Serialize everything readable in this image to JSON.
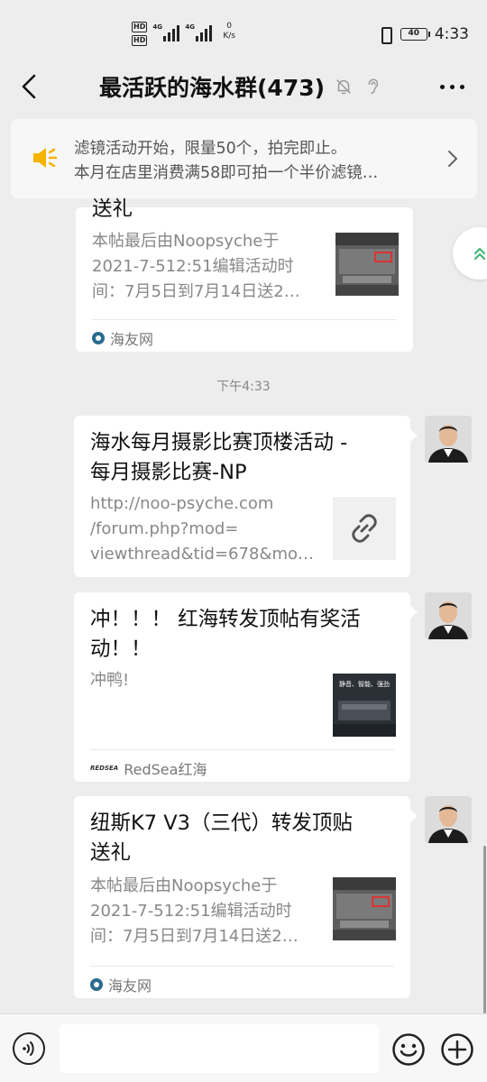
{
  "status_bar": {
    "hd1": "HD",
    "hd2": "HD",
    "net1": "4G",
    "net2": "4G",
    "speed_value": "0",
    "speed_unit": "K/s",
    "battery": "40",
    "time": "4:33"
  },
  "header": {
    "title": "最活跃的海水群(473)",
    "icons": [
      "back-arrow-icon",
      "mute-bell-icon",
      "ear-icon",
      "more-icon"
    ]
  },
  "notice": {
    "line1": "滤镜活动开始，限量50个，拍完即止。",
    "line2": "本月在店里消费满58即可拍一个半价滤镜…",
    "icon": "speaker-icon",
    "accent": "#f4b400"
  },
  "messages": {
    "partial": {
      "title_tail": "送礼",
      "desc": [
        "本帖最后由Noopsyche于",
        "2021-7-512:51编辑活动时",
        "间：7月5日到7月14日送2…"
      ],
      "source": "海友网"
    },
    "timestamp": "下午4:33",
    "m1": {
      "title": [
        "海水每月摄影比赛顶楼活动 -",
        "每月摄影比赛-NP"
      ],
      "desc": [
        "http://noo-psyche.com",
        "/forum.php?mod=",
        "viewthread&tid=678&mo…"
      ],
      "thumb_icon": "link-icon"
    },
    "m2": {
      "title": [
        "冲！！！ 红海转发顶帖有奖活",
        "动！！"
      ],
      "desc": [
        "冲鸭!"
      ],
      "thumb_text": "静音、智能、强劲",
      "source": "RedSea红海",
      "source_logo": "REDSEA"
    },
    "m3": {
      "title": [
        "纽斯K7 V3（三代）转发顶贴",
        "送礼"
      ],
      "desc": [
        "本帖最后由Noopsyche于",
        "2021-7-512:51编辑活动时",
        "间：7月5日到7月14日送2…"
      ],
      "source": "海友网"
    }
  },
  "input_bar": {
    "icons": [
      "voice-icon",
      "emoji-icon",
      "plus-icon"
    ]
  }
}
